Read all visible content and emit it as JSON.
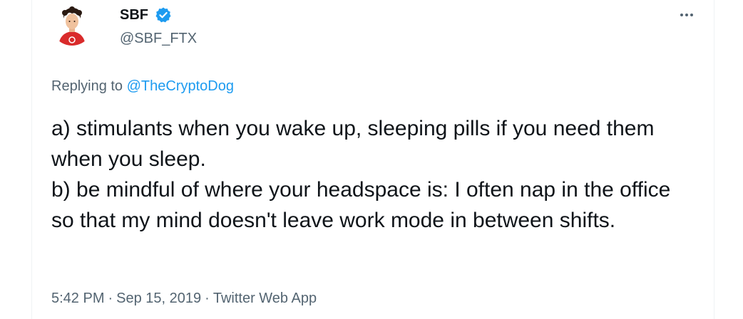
{
  "author": {
    "display_name": "SBF",
    "handle": "@SBF_FTX",
    "verified": true,
    "avatar_icon": "avatar-icon"
  },
  "reply": {
    "prefix": "Replying to",
    "target": "@TheCryptoDog"
  },
  "tweet": {
    "lines": [
      "a) stimulants when you wake up, sleeping pills if you need them when you sleep.",
      "b) be mindful of where your headspace is: I often nap in the office so that my mind doesn't leave work mode in between shifts."
    ]
  },
  "meta": {
    "time": "5:42 PM",
    "separator": "·",
    "date": "Sep 15, 2019",
    "source": "Twitter Web App"
  },
  "colors": {
    "text_primary": "#0f1419",
    "text_secondary": "#536471",
    "link": "#1d9bf0",
    "verified_badge": "#1d9bf0"
  },
  "icons": {
    "more": "more-dots-icon",
    "verified": "verified-badge-icon"
  }
}
